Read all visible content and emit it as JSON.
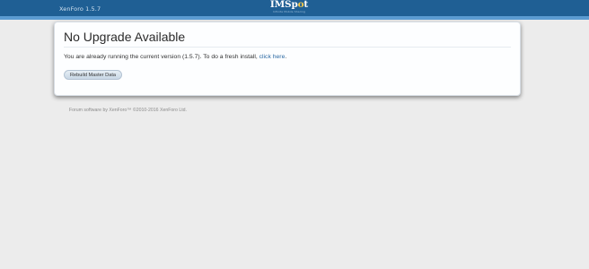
{
  "header": {
    "version": "XenForo 1.5.7",
    "logo_title_prefix": "IMSp",
    "logo_title_o": "o",
    "logo_title_suffix": "t",
    "logo_tagline": "Infinite Mobile Sharing"
  },
  "panel": {
    "title": "No Upgrade Available",
    "message": "You are already running the current version (1.5.7). To do a fresh install, ",
    "link_text": "click here",
    "message_end": ".",
    "button_label": "Rebuild Master Data"
  },
  "footer": {
    "text": "Forum software by XenForo™ ©2010-2016 XenForo Ltd."
  },
  "colors": {
    "header_bg": "#1f5f94",
    "header_stripe": "#5b9bd1",
    "page_bg": "#ececec",
    "link": "#2d6aa3"
  }
}
